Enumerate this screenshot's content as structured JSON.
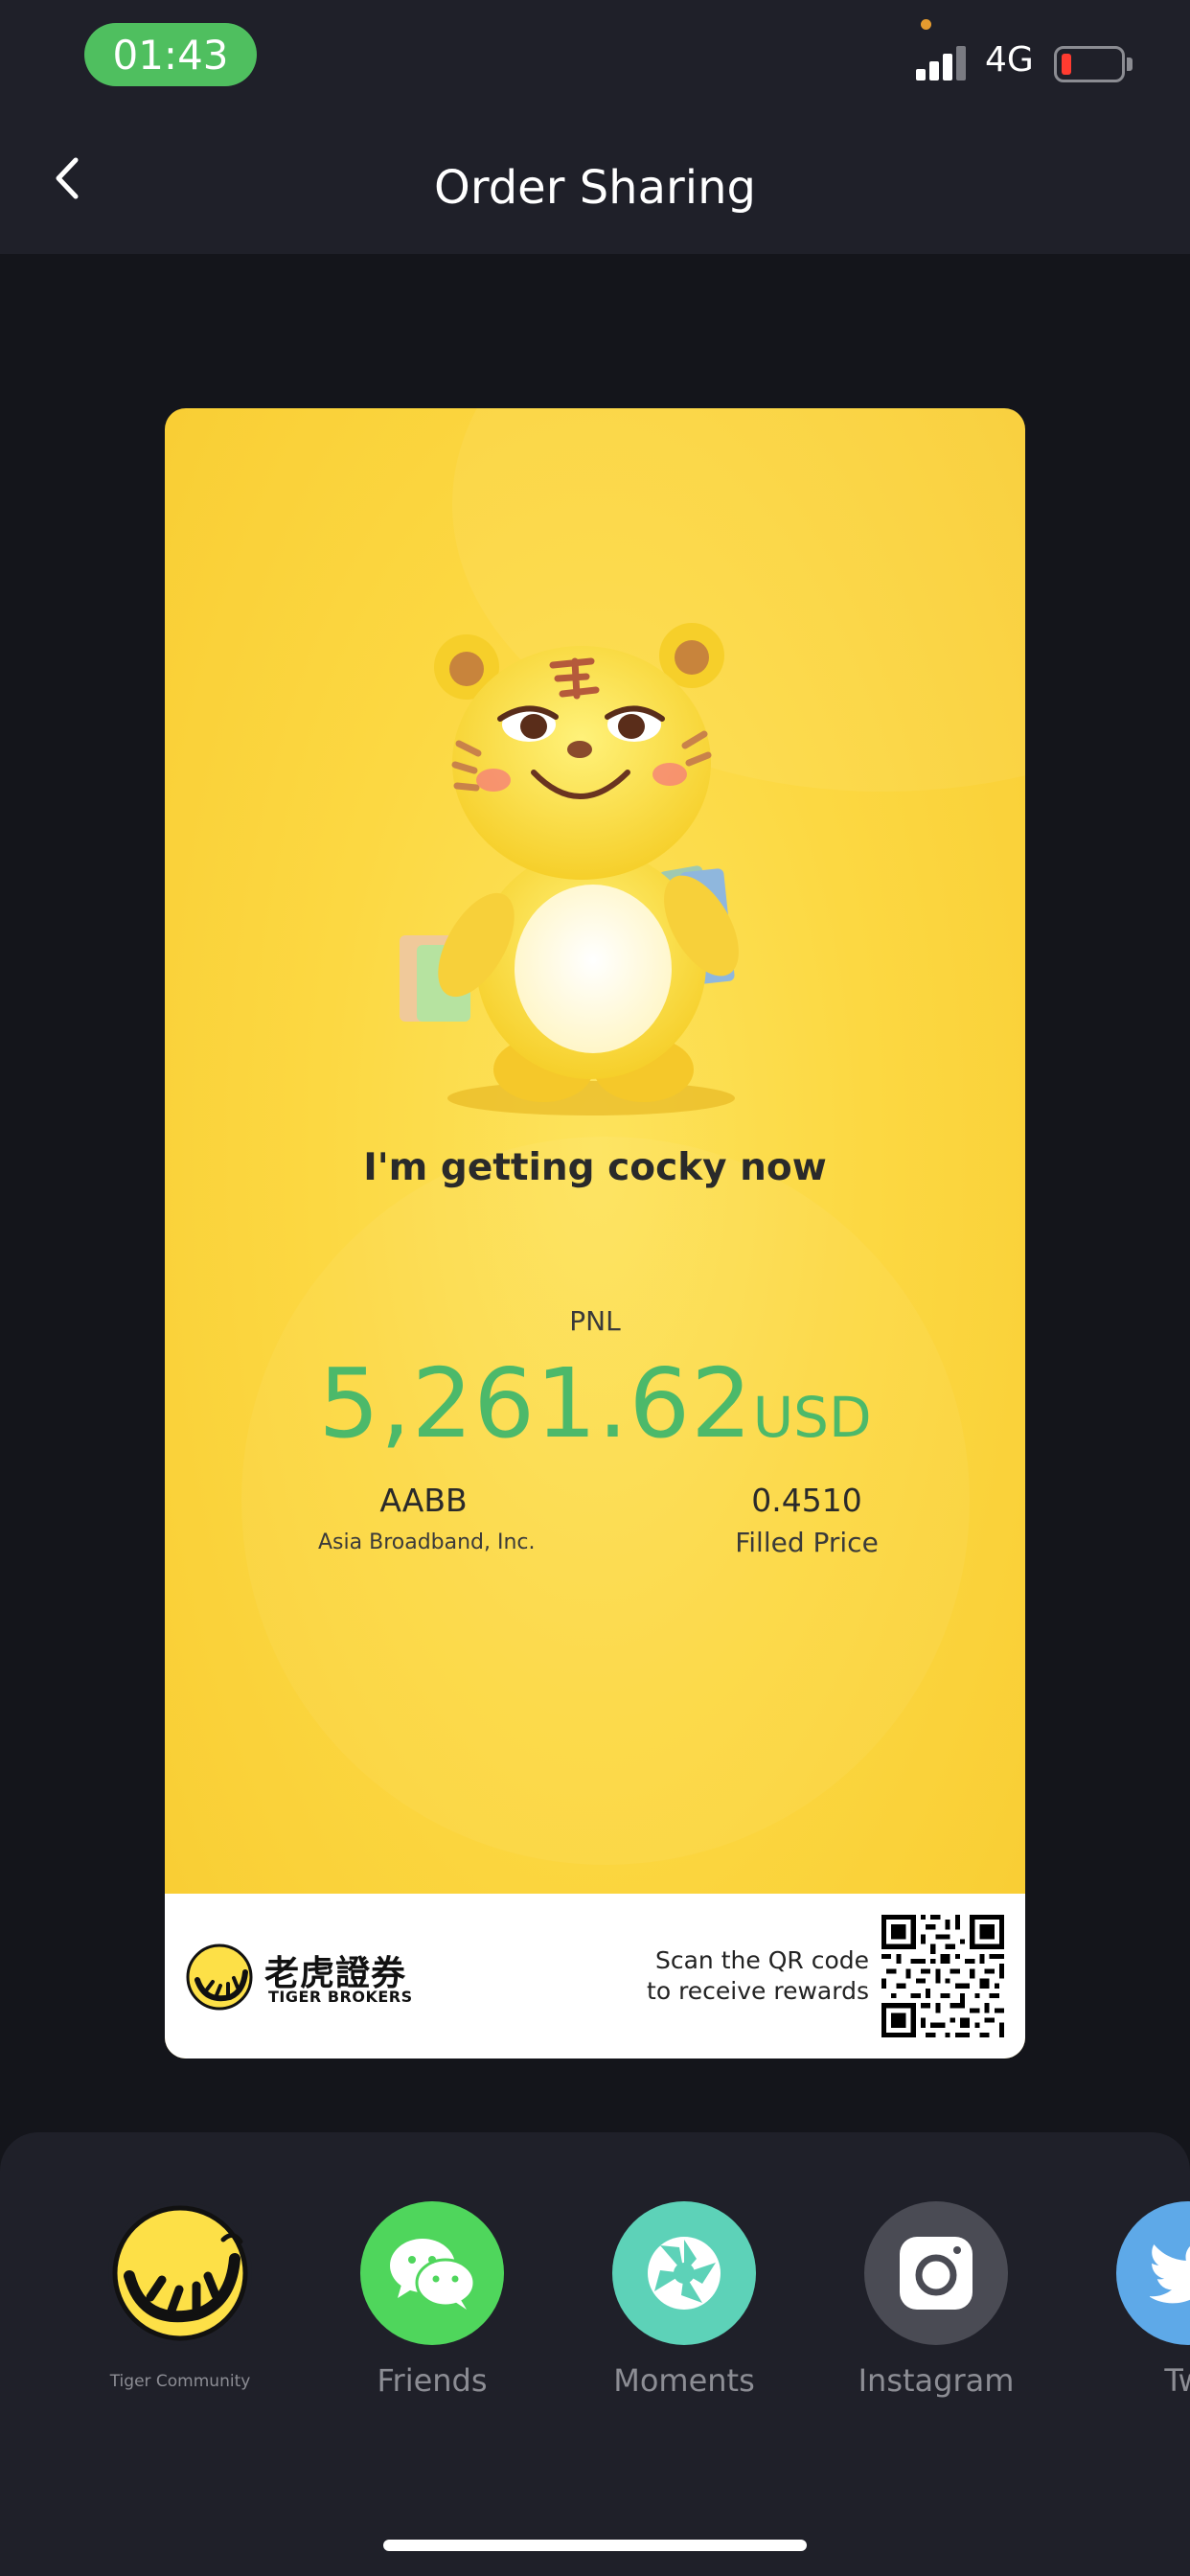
{
  "status_bar": {
    "time": "01:43",
    "network": "4G",
    "signal_bars_active": 3,
    "battery_level": 0.1,
    "colors": {
      "time_pill": "#4fbf5f",
      "battery_low": "#ff3b30"
    }
  },
  "nav": {
    "title": "Order Sharing",
    "back_icon": "chevron-left-icon"
  },
  "card": {
    "tagline": "I'm getting cocky now",
    "pnl_label": "PNL",
    "pnl_amount": "5,261.62",
    "pnl_currency": "USD",
    "symbol": "AABB",
    "company": "Asia Broadband, Inc.",
    "filled_price": "0.4510",
    "filled_price_label": "Filled Price",
    "brand_cn": "老虎證券",
    "brand_en": "TIGER BROKERS",
    "scan_line1": "Scan the QR code",
    "scan_line2": "to receive rewards",
    "colors": {
      "background": "#fcd842",
      "pnl": "#4cb96a"
    }
  },
  "share_options": [
    {
      "label": "Tiger Community",
      "icon": "tiger-community-icon",
      "color": "#fde047"
    },
    {
      "label": "Friends",
      "icon": "wechat-icon",
      "color": "#4fd65c"
    },
    {
      "label": "Moments",
      "icon": "moments-icon",
      "color": "#5dd2b8"
    },
    {
      "label": "Instagram",
      "icon": "instagram-icon",
      "color": "#4a4b54"
    },
    {
      "label": "Twi",
      "icon": "twitter-icon",
      "color": "#5ea9e8"
    }
  ]
}
